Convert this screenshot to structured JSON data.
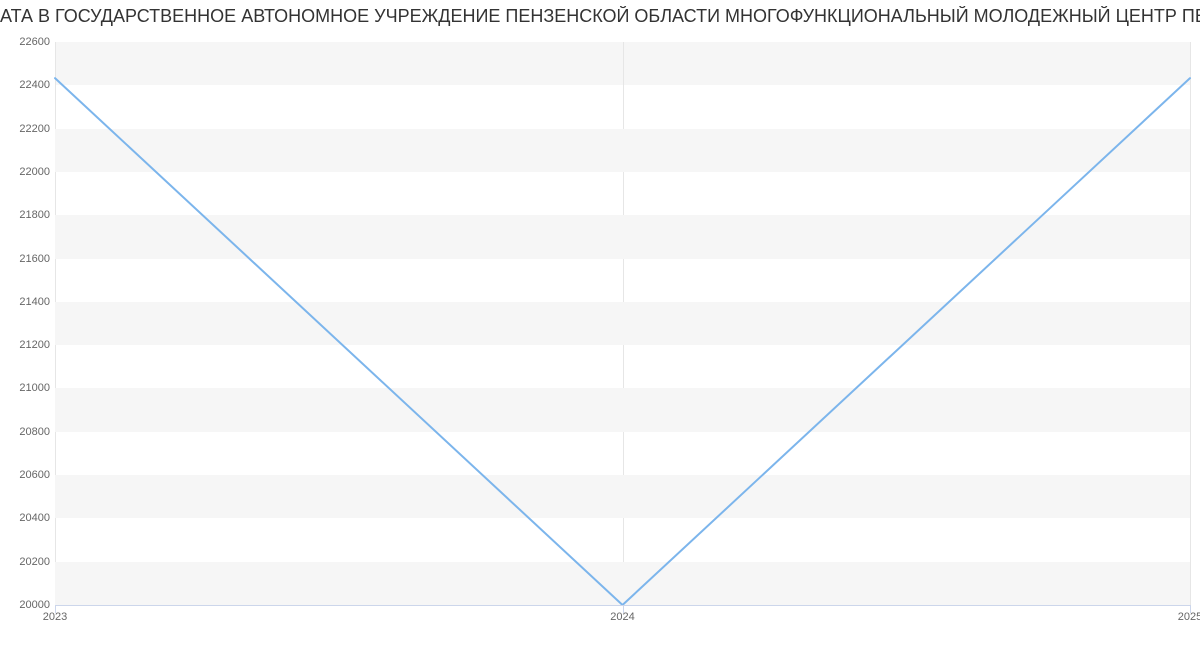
{
  "chart_data": {
    "type": "line",
    "title": "АТА В ГОСУДАРСТВЕННОЕ АВТОНОМНОЕ УЧРЕЖДЕНИЕ ПЕНЗЕНСКОЙ ОБЛАСТИ МНОГОФУНКЦИОНАЛЬНЫЙ МОЛОДЕЖНЫЙ ЦЕНТР ПЕНЗЕНСКОЙ ОБЛАСТИ | Данные mnog",
    "x": [
      2023,
      2024,
      2025
    ],
    "values": [
      22433,
      20000,
      22433
    ],
    "x_ticks": [
      2023,
      2024,
      2025
    ],
    "y_ticks": [
      20000,
      20200,
      20400,
      20600,
      20800,
      21000,
      21200,
      21400,
      21600,
      21800,
      22000,
      22200,
      22400,
      22600
    ],
    "xlim": [
      2023,
      2025
    ],
    "ylim": [
      20000,
      22600
    ],
    "xlabel": "",
    "ylabel": "",
    "series_color": "#7cb5ec",
    "band_color": "#f6f6f6"
  }
}
